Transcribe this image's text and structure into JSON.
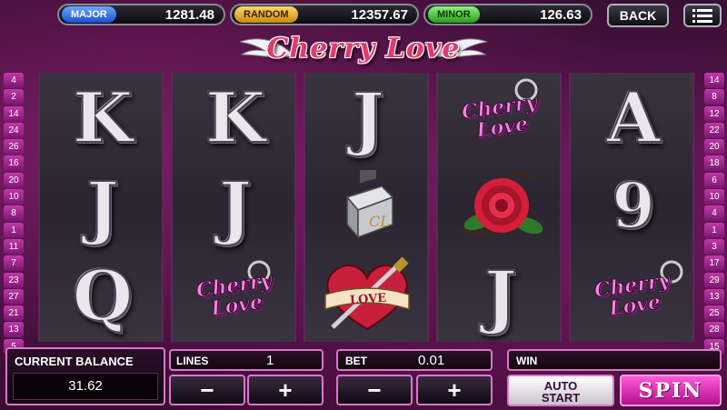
{
  "jackpots": {
    "major": {
      "label": "MAJOR",
      "value": "1281.48"
    },
    "random": {
      "label": "RANDOM",
      "value": "12357.67"
    },
    "minor": {
      "label": "MINOR",
      "value": "126.63"
    }
  },
  "header": {
    "back_label": "BACK",
    "menu_icon": "hamburger-menu-icon",
    "title": "Cherry Love"
  },
  "paylines": {
    "left": [
      "4",
      "2",
      "14",
      "24",
      "26",
      "16",
      "20",
      "10",
      "8",
      "1",
      "11",
      "7",
      "23",
      "27",
      "21",
      "13",
      "5"
    ],
    "right": [
      "14",
      "8",
      "12",
      "22",
      "20",
      "18",
      "6",
      "10",
      "4",
      "1",
      "3",
      "17",
      "29",
      "13",
      "25",
      "28",
      "15"
    ]
  },
  "reels": [
    {
      "symbols": [
        "K",
        "J",
        "Q"
      ]
    },
    {
      "symbols": [
        "K",
        "J",
        "Cherry Love"
      ]
    },
    {
      "symbols": [
        "J",
        "Lighter",
        "LOVE"
      ]
    },
    {
      "symbols": [
        "Cherry Love",
        "Rose",
        "J"
      ]
    },
    {
      "symbols": [
        "A",
        "9",
        "Cherry Love"
      ]
    }
  ],
  "bottom": {
    "balance_label": "CURRENT BALANCE",
    "balance_value": "31.62",
    "lines_label": "LINES",
    "lines_value": "1",
    "bet_label": "BET",
    "bet_value": "0.01",
    "win_label": "WIN",
    "win_value": "",
    "minus": "−",
    "plus": "+",
    "auto_line1": "AUTO",
    "auto_line2": "START",
    "spin_label": "SPIN"
  },
  "colors": {
    "background": "#5a1650",
    "accent": "#d878c8",
    "spin": "#e02ab4"
  }
}
